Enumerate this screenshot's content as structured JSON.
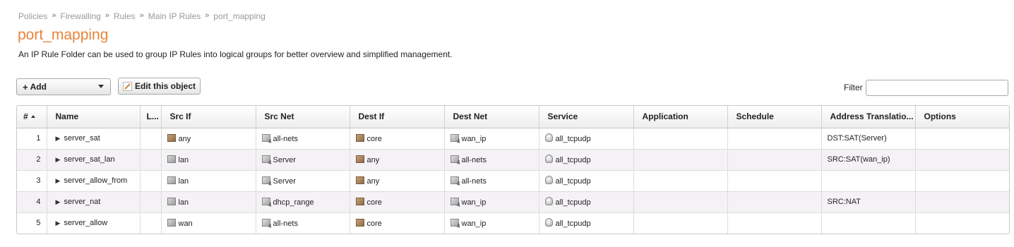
{
  "breadcrumb": [
    "Policies",
    "Firewalling",
    "Rules",
    "Main IP Rules",
    "port_mapping"
  ],
  "breadcrumb_separator": "»",
  "page_title": "port_mapping",
  "description": "An IP Rule Folder can be used to group IP Rules into logical groups for better overview and simplified management.",
  "toolbar": {
    "add_plus": "+",
    "add_label": "Add",
    "edit_label": "Edit this object",
    "filter_label": "Filter",
    "filter_value": ""
  },
  "table": {
    "columns": [
      "#",
      "Name",
      "L...",
      "Src If",
      "Src Net",
      "Dest If",
      "Dest Net",
      "Service",
      "Application",
      "Schedule",
      "Address Translatio...",
      "Options"
    ],
    "rows": [
      {
        "num": "1",
        "name": "server_sat",
        "log": "",
        "src_if": "any",
        "src_if_icon": "interface-brown-icon",
        "src_net": "all-nets",
        "dest_if": "core",
        "dest_if_icon": "interface-brown-icon",
        "dest_net": "wan_ip",
        "service": "all_tcpudp",
        "application": "",
        "schedule": "",
        "address_translation": "DST:SAT(Server)",
        "options": ""
      },
      {
        "num": "2",
        "name": "server_sat_lan",
        "log": "",
        "src_if": "lan",
        "src_if_icon": "interface-grey-icon",
        "src_net": "Server",
        "dest_if": "any",
        "dest_if_icon": "interface-brown-icon",
        "dest_net": "all-nets",
        "service": "all_tcpudp",
        "application": "",
        "schedule": "",
        "address_translation": "SRC:SAT(wan_ip)",
        "options": ""
      },
      {
        "num": "3",
        "name": "server_allow_from",
        "log": "",
        "src_if": "lan",
        "src_if_icon": "interface-grey-icon",
        "src_net": "Server",
        "dest_if": "any",
        "dest_if_icon": "interface-brown-icon",
        "dest_net": "all-nets",
        "service": "all_tcpudp",
        "application": "",
        "schedule": "",
        "address_translation": "",
        "options": ""
      },
      {
        "num": "4",
        "name": "server_nat",
        "log": "",
        "src_if": "lan",
        "src_if_icon": "interface-grey-icon",
        "src_net": "dhcp_range",
        "dest_if": "core",
        "dest_if_icon": "interface-brown-icon",
        "dest_net": "wan_ip",
        "service": "all_tcpudp",
        "application": "",
        "schedule": "",
        "address_translation": "SRC:NAT",
        "options": ""
      },
      {
        "num": "5",
        "name": "server_allow",
        "log": "",
        "src_if": "wan",
        "src_if_icon": "interface-grey-icon",
        "src_net": "all-nets",
        "dest_if": "core",
        "dest_if_icon": "interface-brown-icon",
        "dest_net": "wan_ip",
        "service": "all_tcpudp",
        "application": "",
        "schedule": "",
        "address_translation": "",
        "options": ""
      }
    ]
  },
  "colors": {
    "title": "#e8843a",
    "row_alt": "#f5f2f6"
  }
}
